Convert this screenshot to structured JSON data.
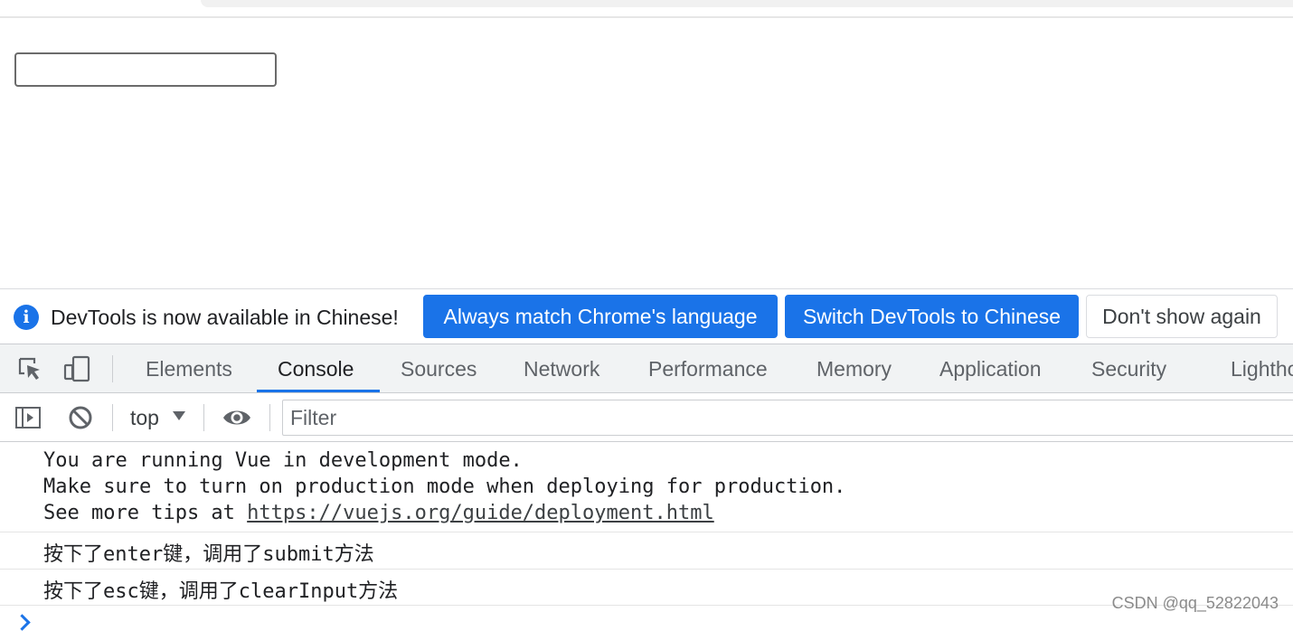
{
  "page": {
    "input_value": "",
    "input_placeholder": ""
  },
  "infobar": {
    "message": "DevTools is now available in Chinese!",
    "buttons": {
      "match": "Always match Chrome's language",
      "switch": "Switch DevTools to Chinese",
      "dont_show": "Don't show again"
    }
  },
  "tabs": [
    {
      "label": "Elements"
    },
    {
      "label": "Console",
      "active": true
    },
    {
      "label": "Sources"
    },
    {
      "label": "Network"
    },
    {
      "label": "Performance"
    },
    {
      "label": "Memory"
    },
    {
      "label": "Application"
    },
    {
      "label": "Security"
    },
    {
      "label": "Lighthouse"
    }
  ],
  "toolbar": {
    "context": "top",
    "filter_placeholder": "Filter"
  },
  "console": {
    "vue_notice": {
      "line1": "You are running Vue in development mode.",
      "line2": "Make sure to turn on production mode when deploying for production.",
      "line3_prefix": "See more tips at ",
      "link": "https://vuejs.org/guide/deployment.html"
    },
    "messages": [
      "按下了enter键，调用了submit方法",
      "按下了esc键，调用了clearInput方法"
    ]
  },
  "watermark": "CSDN @qq_52822043",
  "colors": {
    "accent": "#1a73e8",
    "tabbar_bg": "#f1f3f4",
    "text": "#202124",
    "muted": "#5f6368"
  },
  "icons": {
    "inspect": "inspect-element-icon",
    "device": "device-toolbar-icon",
    "sidebar": "show-sidebar-icon",
    "clear": "clear-console-icon",
    "eye": "live-expression-eye-icon",
    "info": "info-icon",
    "chevron": "console-prompt-chevron-icon"
  }
}
